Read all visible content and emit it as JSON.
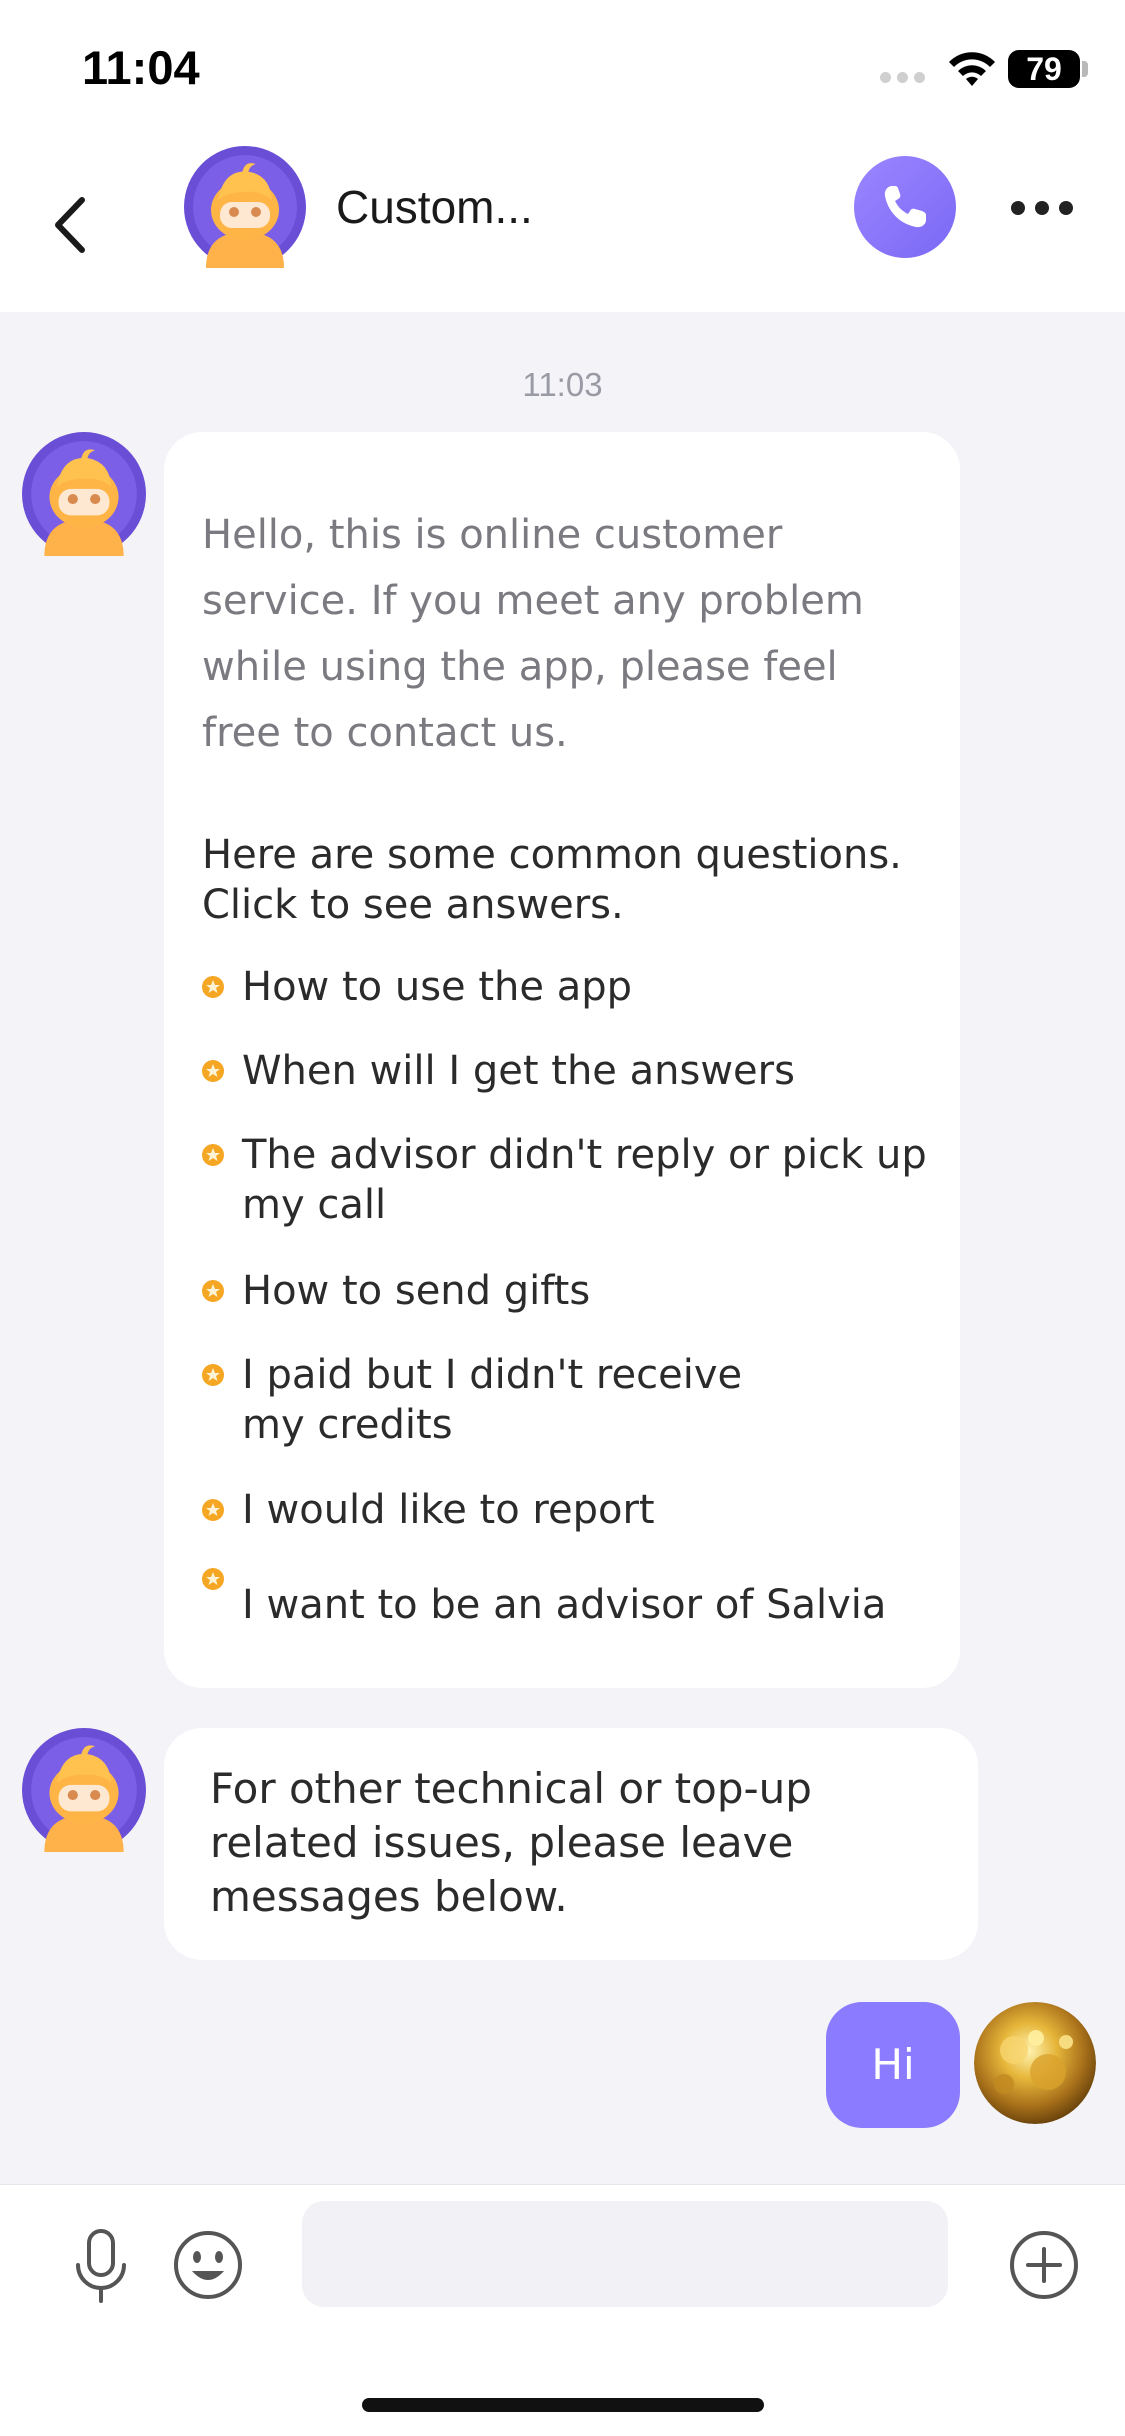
{
  "status_bar": {
    "time": "11:04",
    "battery": "79"
  },
  "header": {
    "title": "Custom..."
  },
  "chat": {
    "timestamp": "11:03",
    "intro_message": "Hello, this is online customer service. If you meet any problem while using the app, please feel free to contact us.",
    "faq_intro": "Here are some common questions. Click to see answers.",
    "faq_items": [
      "How to use the app",
      "When will I get the answers",
      "The advisor didn't reply or pick up my call",
      "How to send gifts",
      "I paid but I didn't receive my credits",
      "I would like to report",
      "I want to be an advisor of Salvia"
    ],
    "followup_message": "For other technical or top-up related issues, please leave messages below.",
    "user_message": "Hi"
  },
  "input": {
    "value": ""
  },
  "colors": {
    "accent": "#8b7cff",
    "background": "#f3f3f8",
    "bubble": "#ffffff",
    "star": "#f5a623"
  },
  "icons": {
    "back": "chevron-left-icon",
    "call": "phone-icon",
    "more": "ellipsis-icon",
    "mic": "microphone-icon",
    "emoji": "smiley-icon",
    "plus": "plus-circle-icon"
  }
}
